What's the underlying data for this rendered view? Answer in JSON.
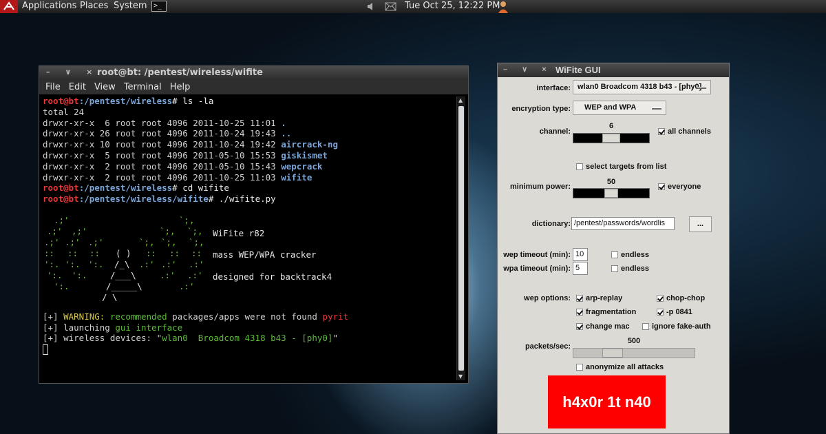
{
  "panel": {
    "menu": [
      "Applications",
      "Places",
      "System"
    ],
    "launcher": ">_",
    "clock": "Tue Oct 25, 12:22 PM"
  },
  "terminal": {
    "title": "root@bt: /pentest/wireless/wifite",
    "title_buttons": "– ∨ ×",
    "menu": [
      "File",
      "Edit",
      "View",
      "Terminal",
      "Help"
    ],
    "lines": {
      "cmd1_user": "root@bt",
      "cmd1_path": ":/pentest/wireless",
      "cmd1_cmd": "# ls -la",
      "total": "total 24",
      "ls": [
        {
          "perm": "drwxr-xr-x  6 root root 4096 2011-10-25 11:01 ",
          "name": "."
        },
        {
          "perm": "drwxr-xr-x 26 root root 4096 2011-10-24 19:43 ",
          "name": ".."
        },
        {
          "perm": "drwxr-xr-x 10 root root 4096 2011-10-24 19:42 ",
          "name": "aircrack-ng"
        },
        {
          "perm": "drwxr-xr-x  5 root root 4096 2011-05-10 15:53 ",
          "name": "giskismet"
        },
        {
          "perm": "drwxr-xr-x  2 root root 4096 2011-05-10 15:43 ",
          "name": "wepcrack"
        },
        {
          "perm": "drwxr-xr-x  2 root root 4096 2011-10-25 11:03 ",
          "name": "wifite"
        }
      ],
      "cmd2_user": "root@bt",
      "cmd2_path": ":/pentest/wireless",
      "cmd2_cmd": "# cd wifite",
      "cmd3_user": "root@bt",
      "cmd3_path": ":/pentest/wireless/wifite",
      "cmd3_cmd": "# ./wifite.py",
      "banner1": "WiFite r82",
      "banner2": "mass WEP/WPA cracker",
      "banner3": "designed for backtrack4",
      "warn_prefix": "[+] ",
      "warn_label": "WARNING: ",
      "warn_text": "recommended",
      "warn_rest": " packages/apps were not found ",
      "warn_pkg": "pyrit",
      "launch_prefix": "[+] launching ",
      "launch_gui": "gui interface",
      "dev_prefix": "[+] wireless devices: \"",
      "dev_value": "wlan0  Broadcom 4318 b43 - [phy0]",
      "dev_suffix": "\""
    }
  },
  "wifite": {
    "title": "WiFite GUI",
    "title_buttons": "– ∨ ×",
    "interface_label": "interface:",
    "interface_value": "wlan0  Broadcom 4318 b43 - [phy0]",
    "encryption_label": "encryption type:",
    "encryption_value": "WEP and WPA",
    "channel_label": "channel:",
    "channel_value": "6",
    "channel_level": 0.5,
    "all_channels": "all channels",
    "select_targets": "select targets from list",
    "min_power_label": "minimum power:",
    "min_power_value": "50",
    "everyone": "everyone",
    "dictionary_label": "dictionary:",
    "dictionary_value": "/pentest/passwords/wordlis",
    "browse": "...",
    "wep_timeout_label": "wep timeout (min):",
    "wep_timeout_value": "10",
    "wpa_timeout_label": "wpa timeout (min):",
    "wpa_timeout_value": "5",
    "endless": "endless",
    "wep_options_label": "wep options:",
    "arp_replay": "arp-replay",
    "chop_chop": "chop-chop",
    "fragmentation": "fragmentation",
    "p0841": "-p 0841",
    "change_mac": "change mac",
    "ignore_fake": "ignore fake-auth",
    "packets_label": "packets/sec:",
    "packets_value": "500",
    "anonymize": "anonymize all attacks",
    "go": "h4x0r 1t n40",
    "accent": "#ff0000"
  }
}
